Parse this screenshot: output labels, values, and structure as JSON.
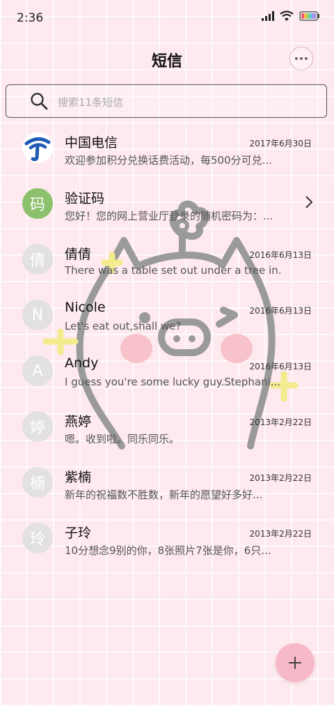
{
  "status_bar": {
    "time": "2:36",
    "icons": [
      "signal-icon",
      "wifi-icon",
      "battery-icon"
    ]
  },
  "header": {
    "title": "短信",
    "more_icon": "more-icon"
  },
  "search": {
    "placeholder": "搜索11条短信",
    "icon": "search-icon"
  },
  "conversations": [
    {
      "name": "中国电信",
      "avatar": "",
      "avatar_type": "logo",
      "date": "2017年6月30日",
      "preview": "欢迎参加积分兑换话费活动，每500分可兑..."
    },
    {
      "name": "验证码",
      "avatar": "码",
      "avatar_type": "green",
      "date": "",
      "preview": "您好！您的网上营业厅登录的随机密码为：..."
    },
    {
      "name": "倩倩",
      "avatar": "倩",
      "avatar_type": "gray",
      "date": "2016年6月13日",
      "preview": "There was a table set out under a tree in..."
    },
    {
      "name": "Nicole",
      "avatar": "N",
      "avatar_type": "gray",
      "date": "2016年6月13日",
      "preview": "Let's eat out,shall we?"
    },
    {
      "name": "Andy",
      "avatar": "A",
      "avatar_type": "gray",
      "date": "2016年6月13日",
      "preview": "I guess you're some lucky guy.Stephani..."
    },
    {
      "name": "燕婷",
      "avatar": "婷",
      "avatar_type": "gray",
      "date": "2013年2月22日",
      "preview": "嗯。收到啦。同乐同乐。"
    },
    {
      "name": "紫楠",
      "avatar": "楠",
      "avatar_type": "gray",
      "date": "2013年2月22日",
      "preview": "新年的祝福数不胜数，新年的愿望好多好..."
    },
    {
      "name": "子玲",
      "avatar": "玲",
      "avatar_type": "gray",
      "date": "2013年2月22日",
      "preview": "10分想念9别的你，8张照片7张是你，6只..."
    }
  ],
  "fab": {
    "icon": "plus-icon"
  },
  "colors": {
    "background": "#fde9ee",
    "accent": "#f7b8c8",
    "avatar_green": "#8cc06c",
    "avatar_gray": "#dedede"
  }
}
